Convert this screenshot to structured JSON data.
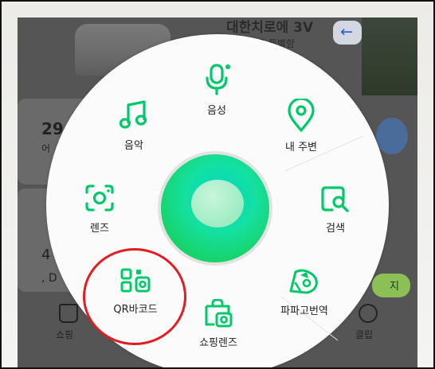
{
  "background": {
    "top_title": "대한치로에 3V",
    "top_sub": "을 특별함",
    "back_label": "←",
    "card_29": "29",
    "card_29_sub": "어",
    "card_4": "4",
    "card_4_sub": ", D",
    "bottom_left_label": "쇼핑",
    "bottom_right_label": "클립",
    "partial_button": "지"
  },
  "menu": {
    "items": {
      "voice": {
        "label": "음성",
        "icon": "mic-icon"
      },
      "music": {
        "label": "음악",
        "icon": "music-icon"
      },
      "nearby": {
        "label": "내 주변",
        "icon": "location-pin-icon"
      },
      "lens": {
        "label": "렌즈",
        "icon": "camera-lens-icon"
      },
      "search": {
        "label": "검색",
        "icon": "search-icon"
      },
      "qr": {
        "label": "QR바코드",
        "icon": "qr-barcode-icon"
      },
      "papago": {
        "label": "파파고번역",
        "icon": "papago-translate-icon"
      },
      "shopping_lens": {
        "label": "쇼핑렌즈",
        "icon": "shopping-lens-icon"
      }
    }
  },
  "colors": {
    "accent_green": "#00c96a",
    "highlight_red": "#e21c21"
  }
}
